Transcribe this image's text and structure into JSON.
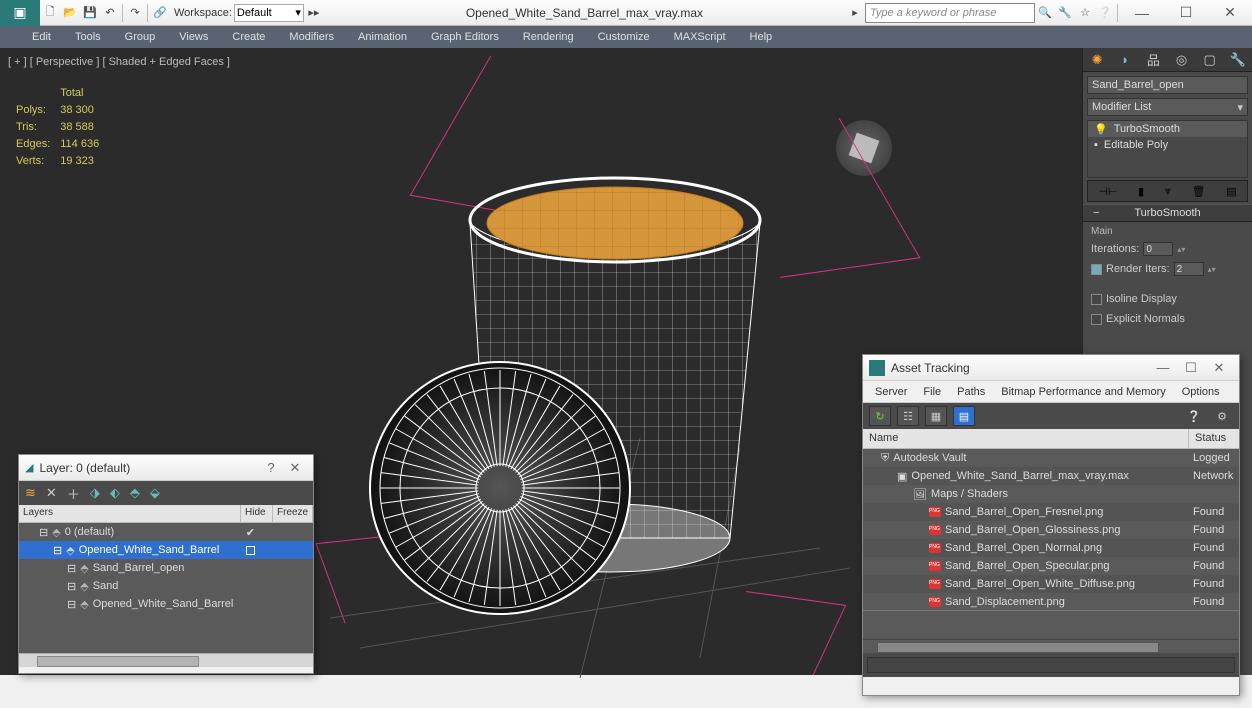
{
  "title": "Opened_White_Sand_Barrel_max_vray.max",
  "workspace": {
    "label": "Workspace:",
    "value": "Default"
  },
  "search_placeholder": "Type a keyword or phrase",
  "menu": [
    "Edit",
    "Tools",
    "Group",
    "Views",
    "Create",
    "Modifiers",
    "Animation",
    "Graph Editors",
    "Rendering",
    "Customize",
    "MAXScript",
    "Help"
  ],
  "viewport_label": "[ + ] [ Perspective ] [ Shaded + Edged Faces ]",
  "stats": {
    "head": "Total",
    "rows": [
      {
        "k": "Polys:",
        "v": "38 300"
      },
      {
        "k": "Tris:",
        "v": "38 588"
      },
      {
        "k": "Edges:",
        "v": "114 636"
      },
      {
        "k": "Verts:",
        "v": "19 323"
      }
    ]
  },
  "cmd": {
    "name": "Sand_Barrel_open",
    "modlist": "Modifier List",
    "stack": [
      "TurboSmooth",
      "Editable Poly"
    ],
    "rollout": "TurboSmooth",
    "section": "Main",
    "iter_label": "Iterations:",
    "iter_val": "0",
    "render_label": "Render Iters:",
    "render_val": "2",
    "isoline": "Isoline Display",
    "explicit": "Explicit Normals"
  },
  "layer": {
    "title": "Layer: 0 (default)",
    "head": [
      "Layers",
      "Hide",
      "Freeze"
    ],
    "rows": [
      {
        "indent": 0,
        "name": "0 (default)",
        "check": true
      },
      {
        "indent": 1,
        "name": "Opened_White_Sand_Barrel",
        "sel": true,
        "box": true
      },
      {
        "indent": 2,
        "name": "Sand_Barrel_open"
      },
      {
        "indent": 2,
        "name": "Sand"
      },
      {
        "indent": 2,
        "name": "Opened_White_Sand_Barrel"
      }
    ]
  },
  "asset": {
    "title": "Asset Tracking",
    "menu": [
      "Server",
      "File",
      "Paths",
      "Bitmap Performance and Memory",
      "Options"
    ],
    "head": [
      "Name",
      "Status"
    ],
    "rows": [
      {
        "indent": 0,
        "name": "Autodesk Vault",
        "status": "Logged",
        "ico": "vault"
      },
      {
        "indent": 1,
        "name": "Opened_White_Sand_Barrel_max_vray.max",
        "status": "Network",
        "ico": "max"
      },
      {
        "indent": 2,
        "name": "Maps / Shaders",
        "status": "",
        "ico": "folder"
      },
      {
        "indent": 3,
        "name": "Sand_Barrel_Open_Fresnel.png",
        "status": "Found",
        "ico": "png"
      },
      {
        "indent": 3,
        "name": "Sand_Barrel_Open_Glossiness.png",
        "status": "Found",
        "ico": "png"
      },
      {
        "indent": 3,
        "name": "Sand_Barrel_Open_Normal.png",
        "status": "Found",
        "ico": "png"
      },
      {
        "indent": 3,
        "name": "Sand_Barrel_Open_Specular.png",
        "status": "Found",
        "ico": "png"
      },
      {
        "indent": 3,
        "name": "Sand_Barrel_Open_White_Diffuse.png",
        "status": "Found",
        "ico": "png"
      },
      {
        "indent": 3,
        "name": "Sand_Displacement.png",
        "status": "Found",
        "ico": "png",
        "last": true
      }
    ]
  }
}
